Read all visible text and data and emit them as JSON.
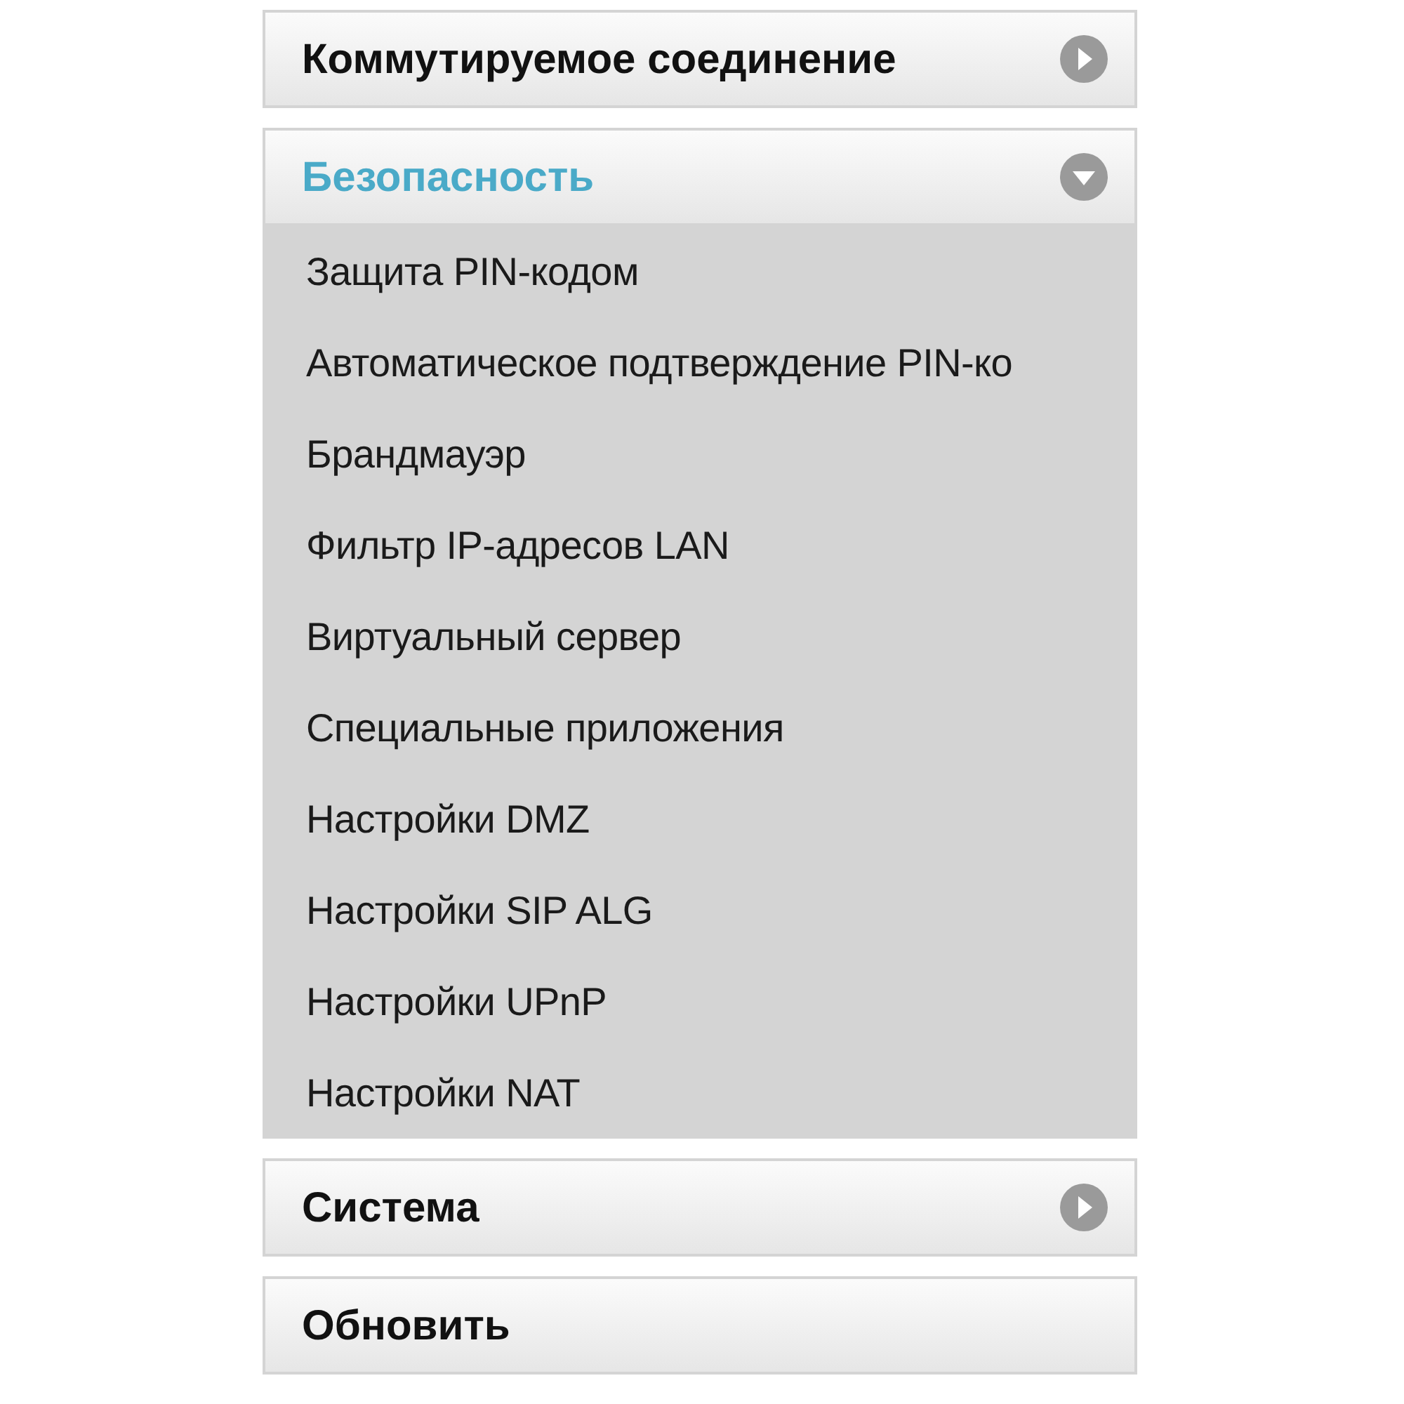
{
  "menu": [
    {
      "kind": "group",
      "title": "Коммутируемое соединение",
      "expanded": false
    },
    {
      "kind": "group",
      "title": "Безопасность",
      "expanded": true,
      "items": [
        {
          "label": "Защита PIN-кодом"
        },
        {
          "label": "Автоматическое подтверждение PIN-ко"
        },
        {
          "label": "Брандмауэр"
        },
        {
          "label": "Фильтр IP-адресов LAN"
        },
        {
          "label": "Виртуальный сервер"
        },
        {
          "label": "Специальные приложения"
        },
        {
          "label": "Настройки DMZ"
        },
        {
          "label": "Настройки SIP ALG"
        },
        {
          "label": "Настройки UPnP"
        },
        {
          "label": "Настройки NAT"
        }
      ]
    },
    {
      "kind": "group",
      "title": "Система",
      "expanded": false
    },
    {
      "kind": "link",
      "title": "Обновить"
    }
  ]
}
